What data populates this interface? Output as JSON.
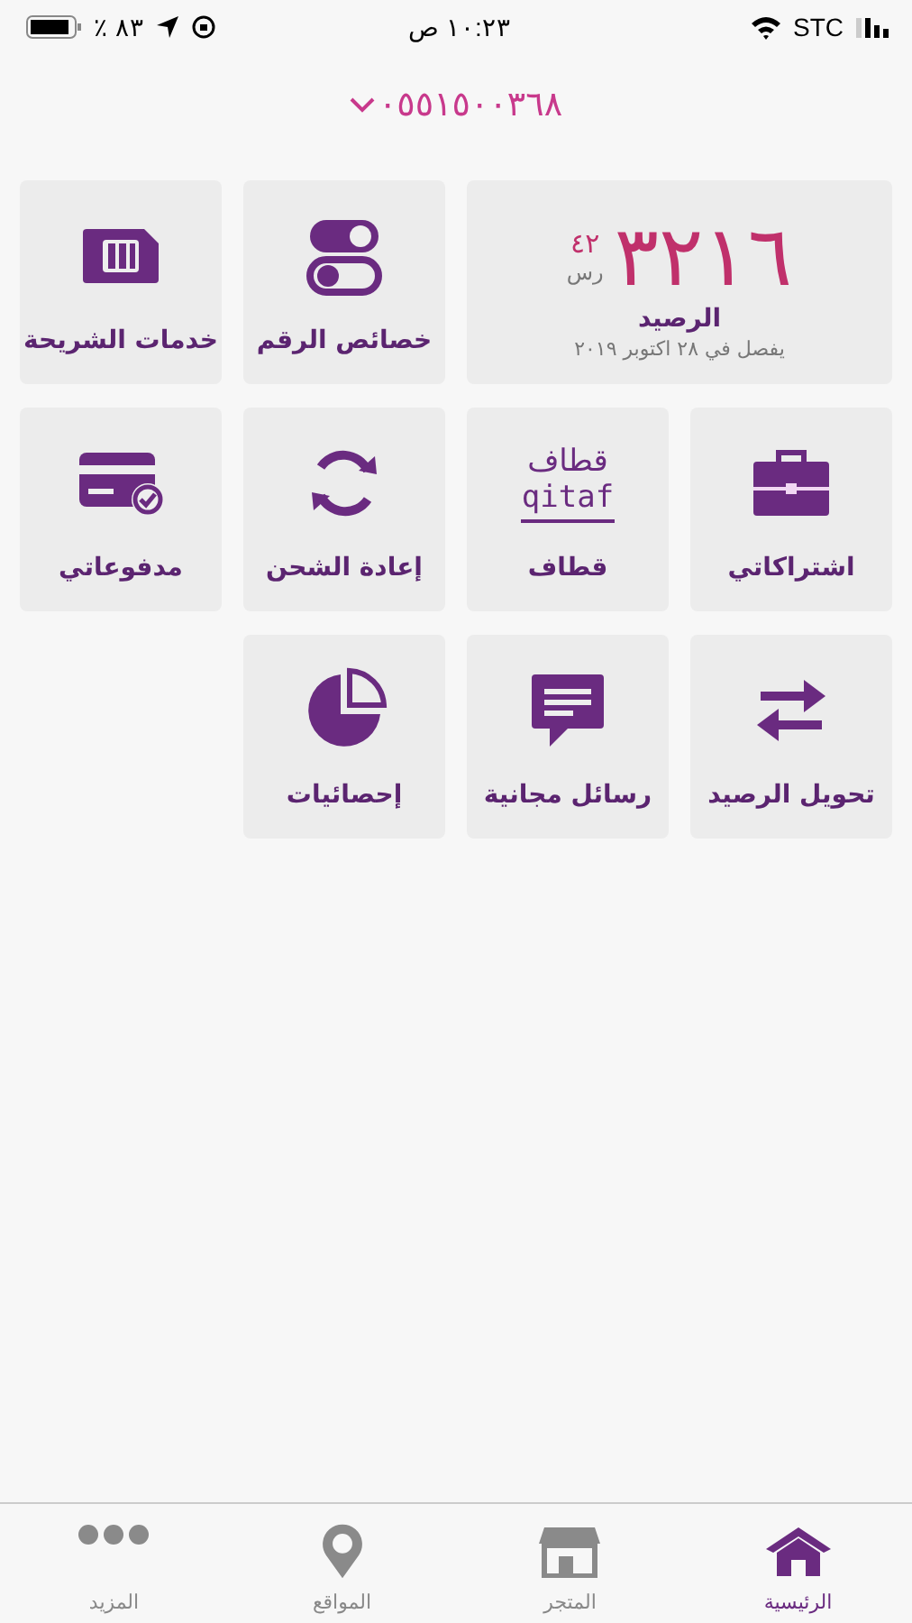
{
  "status_bar": {
    "battery_percent": "٪ ٨٣",
    "time": "١٠:٢٣ ص",
    "carrier": "STC"
  },
  "account": {
    "phone_number": "٠٥٥١٥٠٠٣٦٨"
  },
  "balance": {
    "amount": "٣٢١٦",
    "fraction": "٤٢",
    "currency": "رس",
    "label": "الرصيد",
    "expiry": "يفصل في ٢٨ اكتوبر ٢٠١٩"
  },
  "tiles": [
    {
      "kind": "service",
      "label": "خصائص الرقم"
    },
    {
      "kind": "service",
      "label": "خدمات الشريحة"
    },
    {
      "kind": "service",
      "label": "اشتراكاتي"
    },
    {
      "kind": "logo",
      "label": "قطاف",
      "logo_lines": [
        "قطاف",
        "qitaf"
      ]
    },
    {
      "kind": "service",
      "label": "إعادة الشحن"
    },
    {
      "kind": "service",
      "label": "مدفوعاتي"
    },
    {
      "kind": "service",
      "label": "تحويل الرصيد"
    },
    {
      "kind": "service",
      "label": "رسائل مجانية"
    },
    {
      "kind": "service",
      "label": "إحصائيات"
    }
  ],
  "tab_bar": [
    {
      "label": "الرئيسية",
      "selected": true
    },
    {
      "label": "المتجر",
      "selected": false
    },
    {
      "label": "المواقع",
      "selected": false
    },
    {
      "label": "المزيد",
      "selected": false
    }
  ]
}
